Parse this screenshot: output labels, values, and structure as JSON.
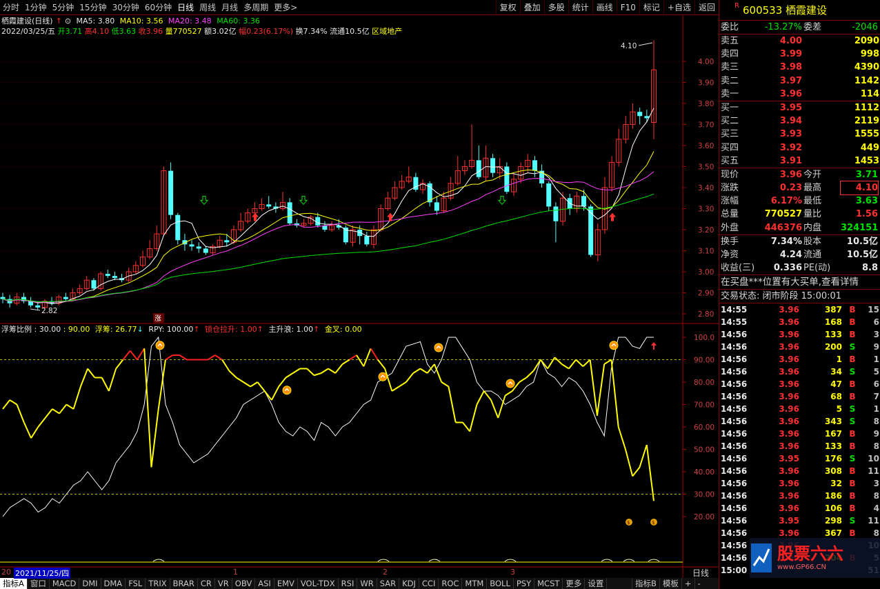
{
  "toolbar": {
    "periods": [
      "分时",
      "1分钟",
      "5分钟",
      "15分钟",
      "30分钟",
      "60分钟",
      "日线",
      "周线",
      "月线",
      "多周期",
      "更多>"
    ],
    "active_period": "日线",
    "buttons": [
      "复权",
      "叠加",
      "多股",
      "统计",
      "画线",
      "F10",
      "标记",
      "+自选",
      "返回"
    ]
  },
  "info": {
    "title": "栖霞建设(日线)",
    "ma5": "MA5: 3.80",
    "ma10": "MA10: 3.56",
    "ma20": "MA20: 3.48",
    "ma60": "MA60: 3.36",
    "date": "2022/03/25/五",
    "open": "开3.71",
    "high": "高4.10",
    "low": "低3.63",
    "close": "收3.96",
    "vol": "量770527",
    "amt": "额3.02亿",
    "chg": "幅0.23(6.17%)",
    "turn": "换7.34%",
    "float": "流通10.5亿",
    "sector": "区域地产"
  },
  "price_axis": [
    "4.00",
    "3.90",
    "3.80",
    "3.70",
    "3.60",
    "3.50",
    "3.40",
    "3.30",
    "3.20",
    "3.10",
    "3.00",
    "2.90",
    "2.80"
  ],
  "high_mark": "4.10",
  "low_mark": "2.82",
  "zhang_mark": "涨",
  "indicator": {
    "ratio": "浮筹比例 : 30.00",
    "p1": ": 90.00",
    "fc": "浮筹: 26.77",
    "rpy": "RPY: 100.00",
    "sc": "锁仓拉升: 1.00",
    "zsl": "主升浪: 1.00",
    "jc": "金叉: 0.00"
  },
  "ind_axis": [
    "100.0",
    "90.00",
    "80.00",
    "70.00",
    "60.00",
    "50.00",
    "40.00",
    "30.00",
    "20.00"
  ],
  "time_axis": {
    "date_box": "2021/11/25/四",
    "start": "20",
    "m1": "1",
    "m2": "2",
    "m3": "3",
    "right": "日线"
  },
  "bottom_tabs": [
    "指标A",
    "窗口",
    "MACD",
    "DMI",
    "DMA",
    "FSL",
    "TRIX",
    "BRAR",
    "CR",
    "VR",
    "OBV",
    "ASI",
    "EMV",
    "VOL-TDX",
    "RSI",
    "WR",
    "SAR",
    "KDJ",
    "CCI",
    "ROC",
    "MTM",
    "BOLL",
    "PSY",
    "MCST",
    "更多",
    "设置"
  ],
  "bottom_right": [
    "指标B",
    "模板",
    "+",
    "-"
  ],
  "stock": {
    "code": "600533",
    "name": "栖霞建设",
    "r": "R"
  },
  "weibi": {
    "l1": "委比",
    "v1": "-13.27%",
    "l2": "委差",
    "v2": "-2046"
  },
  "sells": [
    {
      "l": "卖五",
      "p": "4.00",
      "v": "2090"
    },
    {
      "l": "卖四",
      "p": "3.99",
      "v": "998"
    },
    {
      "l": "卖三",
      "p": "3.98",
      "v": "4390"
    },
    {
      "l": "卖二",
      "p": "3.97",
      "v": "1142"
    },
    {
      "l": "卖一",
      "p": "3.96",
      "v": "114"
    }
  ],
  "buys": [
    {
      "l": "买一",
      "p": "3.95",
      "v": "1112"
    },
    {
      "l": "买二",
      "p": "3.94",
      "v": "2119"
    },
    {
      "l": "买三",
      "p": "3.93",
      "v": "1555"
    },
    {
      "l": "买四",
      "p": "3.92",
      "v": "449"
    },
    {
      "l": "买五",
      "p": "3.91",
      "v": "1453"
    }
  ],
  "quote": [
    {
      "l1": "现价",
      "v1": "3.96",
      "l2": "今开",
      "v2": "3.71"
    },
    {
      "l1": "涨跌",
      "v1": "0.23",
      "l2": "最高",
      "v2": "4.10"
    },
    {
      "l1": "涨幅",
      "v1": "6.17%",
      "l2": "最低",
      "v2": "3.63"
    },
    {
      "l1": "总量",
      "v1": "770527",
      "l2": "量比",
      "v2": "1.56"
    },
    {
      "l1": "外盘",
      "v1": "446376",
      "l2": "内盘",
      "v2": "324151"
    }
  ],
  "quote2": [
    {
      "l1": "换手",
      "v1": "7.34%",
      "l2": "股本",
      "v2": "10.5亿"
    },
    {
      "l1": "净资",
      "v1": "4.24",
      "l2": "流通",
      "v2": "10.5亿"
    },
    {
      "l1": "收益(三)",
      "v1": "0.336",
      "l2": "PE(动)",
      "v2": "8.8"
    }
  ],
  "notice": "在买盘***位置有大买单,查看详情",
  "status": "交易状态: 闭市阶段 15:00:01",
  "ticks": [
    {
      "t": "14:55",
      "p": "3.96",
      "v": "387",
      "bs": "B",
      "n": "15"
    },
    {
      "t": "14:55",
      "p": "3.96",
      "v": "168",
      "bs": "B",
      "n": "6"
    },
    {
      "t": "14:56",
      "p": "3.96",
      "v": "133",
      "bs": "B",
      "n": "3"
    },
    {
      "t": "14:56",
      "p": "3.96",
      "v": "200",
      "bs": "S",
      "n": "9"
    },
    {
      "t": "14:56",
      "p": "3.96",
      "v": "1",
      "bs": "B",
      "n": "1"
    },
    {
      "t": "14:56",
      "p": "3.96",
      "v": "34",
      "bs": "S",
      "n": "5"
    },
    {
      "t": "14:56",
      "p": "3.96",
      "v": "47",
      "bs": "B",
      "n": "6"
    },
    {
      "t": "14:56",
      "p": "3.96",
      "v": "68",
      "bs": "B",
      "n": "7"
    },
    {
      "t": "14:56",
      "p": "3.96",
      "v": "5",
      "bs": "S",
      "n": "1"
    },
    {
      "t": "14:56",
      "p": "3.96",
      "v": "343",
      "bs": "S",
      "n": "8"
    },
    {
      "t": "14:56",
      "p": "3.96",
      "v": "167",
      "bs": "B",
      "n": "9"
    },
    {
      "t": "14:56",
      "p": "3.96",
      "v": "133",
      "bs": "B",
      "n": "8"
    },
    {
      "t": "14:56",
      "p": "3.95",
      "v": "176",
      "bs": "S",
      "n": "10"
    },
    {
      "t": "14:56",
      "p": "3.96",
      "v": "308",
      "bs": "B",
      "n": "11"
    },
    {
      "t": "14:56",
      "p": "3.96",
      "v": "32",
      "bs": "B",
      "n": "3"
    },
    {
      "t": "14:56",
      "p": "3.96",
      "v": "186",
      "bs": "B",
      "n": "8"
    },
    {
      "t": "14:56",
      "p": "3.96",
      "v": "106",
      "bs": "B",
      "n": "4"
    },
    {
      "t": "14:56",
      "p": "3.95",
      "v": "298",
      "bs": "S",
      "n": "11"
    },
    {
      "t": "14:56",
      "p": "3.96",
      "v": "367",
      "bs": "B",
      "n": "8"
    },
    {
      "t": "14:56",
      "p": "3.96",
      "v": "",
      "bs": "",
      "n": "10"
    },
    {
      "t": "14:56",
      "p": "3.96",
      "v": "204",
      "bs": "B",
      "n": "5"
    },
    {
      "t": "15:00",
      "p": "",
      "v": "",
      "bs": "",
      "n": "51"
    }
  ],
  "watermark": {
    "main": "股票六六",
    "sub": "www.GP66.CN"
  },
  "chart_data": {
    "type": "candlestick",
    "price_range": [
      2.78,
      4.1
    ],
    "candles": [
      [
        2.88,
        2.87,
        2.9,
        2.85
      ],
      [
        2.87,
        2.85,
        2.89,
        2.83
      ],
      [
        2.85,
        2.88,
        2.9,
        2.84
      ],
      [
        2.88,
        2.86,
        2.9,
        2.85
      ],
      [
        2.86,
        2.84,
        2.88,
        2.83
      ],
      [
        2.84,
        2.83,
        2.86,
        2.82
      ],
      [
        2.83,
        2.86,
        2.87,
        2.82
      ],
      [
        2.86,
        2.85,
        2.88,
        2.84
      ],
      [
        2.85,
        2.88,
        2.89,
        2.84
      ],
      [
        2.88,
        2.87,
        2.9,
        2.86
      ],
      [
        2.87,
        2.9,
        2.92,
        2.86
      ],
      [
        2.9,
        2.92,
        2.94,
        2.89
      ],
      [
        2.92,
        2.96,
        2.98,
        2.91
      ],
      [
        2.96,
        2.92,
        2.97,
        2.91
      ],
      [
        2.92,
        2.99,
        3.0,
        2.91
      ],
      [
        2.99,
        2.98,
        3.01,
        2.97
      ],
      [
        2.98,
        2.97,
        3.0,
        2.96
      ],
      [
        2.97,
        2.96,
        2.99,
        2.95
      ],
      [
        2.96,
        3.0,
        3.02,
        2.95
      ],
      [
        3.0,
        3.03,
        3.05,
        2.99
      ],
      [
        3.03,
        3.07,
        3.1,
        3.02
      ],
      [
        3.07,
        3.11,
        3.15,
        3.06
      ],
      [
        3.11,
        3.18,
        3.22,
        3.1
      ],
      [
        3.18,
        3.48,
        3.5,
        3.17
      ],
      [
        3.48,
        3.27,
        3.52,
        3.25
      ],
      [
        3.27,
        3.15,
        3.28,
        3.13
      ],
      [
        3.15,
        3.13,
        3.18,
        3.1
      ],
      [
        3.13,
        3.12,
        3.15,
        3.1
      ],
      [
        3.12,
        3.11,
        3.14,
        3.09
      ],
      [
        3.11,
        3.09,
        3.12,
        3.08
      ],
      [
        3.09,
        3.12,
        3.13,
        3.08
      ],
      [
        3.12,
        3.15,
        3.17,
        3.11
      ],
      [
        3.15,
        3.14,
        3.18,
        3.12
      ],
      [
        3.14,
        3.2,
        3.22,
        3.13
      ],
      [
        3.2,
        3.24,
        3.28,
        3.19
      ],
      [
        3.24,
        3.28,
        3.3,
        3.23
      ],
      [
        3.28,
        3.3,
        3.33,
        3.27
      ],
      [
        3.3,
        3.32,
        3.35,
        3.29
      ],
      [
        3.32,
        3.31,
        3.36,
        3.3
      ],
      [
        3.31,
        3.3,
        3.33,
        3.28
      ],
      [
        3.3,
        3.33,
        3.38,
        3.29
      ],
      [
        3.33,
        3.23,
        3.35,
        3.22
      ],
      [
        3.23,
        3.22,
        3.25,
        3.21
      ],
      [
        3.22,
        3.23,
        3.25,
        3.21
      ],
      [
        3.23,
        3.26,
        3.27,
        3.22
      ],
      [
        3.26,
        3.22,
        3.28,
        3.21
      ],
      [
        3.22,
        3.2,
        3.24,
        3.19
      ],
      [
        3.2,
        3.22,
        3.24,
        3.19
      ],
      [
        3.22,
        3.21,
        3.25,
        3.2
      ],
      [
        3.21,
        3.14,
        3.22,
        3.13
      ],
      [
        3.14,
        3.2,
        3.22,
        3.12
      ],
      [
        3.2,
        3.17,
        3.22,
        3.13
      ],
      [
        3.17,
        3.13,
        3.19,
        3.12
      ],
      [
        3.13,
        3.2,
        3.22,
        3.11
      ],
      [
        3.2,
        3.3,
        3.32,
        3.19
      ],
      [
        3.3,
        3.35,
        3.38,
        3.29
      ],
      [
        3.35,
        3.4,
        3.43,
        3.34
      ],
      [
        3.4,
        3.43,
        3.46,
        3.39
      ],
      [
        3.43,
        3.45,
        3.5,
        3.42
      ],
      [
        3.45,
        3.39,
        3.47,
        3.38
      ],
      [
        3.39,
        3.42,
        3.44,
        3.37
      ],
      [
        3.42,
        3.33,
        3.43,
        3.31
      ],
      [
        3.33,
        3.29,
        3.36,
        3.27
      ],
      [
        3.29,
        3.35,
        3.38,
        3.28
      ],
      [
        3.35,
        3.42,
        3.45,
        3.34
      ],
      [
        3.42,
        3.48,
        3.55,
        3.41
      ],
      [
        3.48,
        3.5,
        3.53,
        3.46
      ],
      [
        3.5,
        3.53,
        3.7,
        3.49
      ],
      [
        3.53,
        3.45,
        3.6,
        3.44
      ],
      [
        3.45,
        3.54,
        3.6,
        3.43
      ],
      [
        3.54,
        3.47,
        3.56,
        3.45
      ],
      [
        3.47,
        3.5,
        3.54,
        3.44
      ],
      [
        3.5,
        3.38,
        3.52,
        3.37
      ],
      [
        3.38,
        3.44,
        3.47,
        3.36
      ],
      [
        3.44,
        3.5,
        3.52,
        3.42
      ],
      [
        3.5,
        3.53,
        3.56,
        3.47
      ],
      [
        3.53,
        3.48,
        3.55,
        3.45
      ],
      [
        3.48,
        3.42,
        3.51,
        3.4
      ],
      [
        3.42,
        3.31,
        3.43,
        3.29
      ],
      [
        3.31,
        3.24,
        3.33,
        3.14
      ],
      [
        3.24,
        3.35,
        3.38,
        3.22
      ],
      [
        3.35,
        3.3,
        3.37,
        3.27
      ],
      [
        3.3,
        3.36,
        3.38,
        3.28
      ],
      [
        3.36,
        3.31,
        3.39,
        3.29
      ],
      [
        3.31,
        3.08,
        3.32,
        3.07
      ],
      [
        3.08,
        3.2,
        3.23,
        3.05
      ],
      [
        3.2,
        3.4,
        3.45,
        3.18
      ],
      [
        3.4,
        3.52,
        3.55,
        3.38
      ],
      [
        3.52,
        3.63,
        3.68,
        3.5
      ],
      [
        3.63,
        3.7,
        3.74,
        3.61
      ],
      [
        3.7,
        3.76,
        3.8,
        3.68
      ],
      [
        3.76,
        3.74,
        3.78,
        3.7
      ],
      [
        3.74,
        3.73,
        3.77,
        3.71
      ],
      [
        3.71,
        3.96,
        4.1,
        3.63
      ]
    ],
    "ma_lines": {
      "MA5": "#ffffff",
      "MA10": "#ffff00",
      "MA20": "#ff40ff",
      "MA60": "#00e000"
    },
    "indicator": {
      "ylim": [
        15,
        105
      ],
      "fc": [
        68,
        72,
        70,
        62,
        55,
        60,
        64,
        68,
        66,
        70,
        68,
        78,
        86,
        82,
        82,
        76,
        86,
        90,
        94,
        90,
        95,
        42,
        68,
        90,
        92,
        92,
        90,
        90,
        90,
        90,
        92,
        90,
        85,
        82,
        80,
        78,
        80,
        76,
        72,
        78,
        82,
        84,
        86,
        86,
        83,
        84,
        86,
        84,
        88,
        90,
        92,
        87,
        95,
        90,
        86,
        76,
        78,
        80,
        84,
        86,
        84,
        88,
        80,
        78,
        62,
        62,
        58,
        70,
        76,
        72,
        64,
        74,
        76,
        80,
        82,
        85,
        90,
        86,
        91,
        88,
        86,
        90,
        87,
        90,
        65,
        88,
        90,
        60,
        50,
        38,
        42,
        52,
        27
      ],
      "rpy": [
        20,
        24,
        26,
        28,
        26,
        22,
        24,
        28,
        26,
        30,
        34,
        36,
        40,
        36,
        32,
        36,
        44,
        48,
        52,
        58,
        70,
        96,
        100,
        70,
        62,
        52,
        48,
        44,
        46,
        48,
        52,
        56,
        60,
        64,
        70,
        72,
        74,
        76,
        70,
        62,
        58,
        56,
        60,
        58,
        54,
        62,
        60,
        56,
        60,
        62,
        66,
        70,
        72,
        80,
        82,
        84,
        90,
        96,
        97,
        98,
        88,
        84,
        90,
        100,
        100,
        95,
        90,
        80,
        76,
        76,
        74,
        70,
        72,
        74,
        78,
        80,
        90,
        84,
        82,
        78,
        82,
        80,
        76,
        70,
        62,
        56,
        86,
        100,
        100,
        96,
        95,
        100,
        100
      ]
    }
  }
}
